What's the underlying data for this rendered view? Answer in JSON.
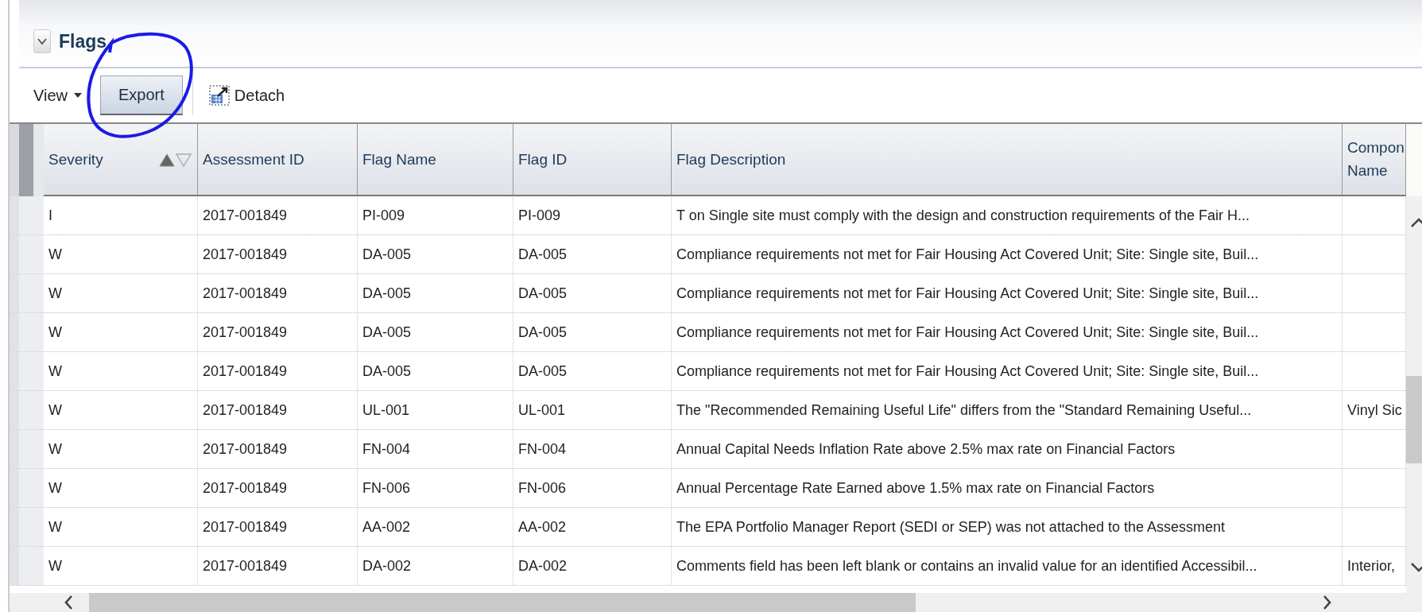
{
  "panel": {
    "title": "Flags",
    "expanded": true
  },
  "toolbar": {
    "view_menu": "View",
    "export_button": "Export",
    "detach_button": "Detach"
  },
  "table": {
    "columns": [
      {
        "label": "Severity",
        "sorted_ascending": true
      },
      {
        "label": "Assessment ID"
      },
      {
        "label": "Flag Name"
      },
      {
        "label": "Flag ID"
      },
      {
        "label": "Flag Description"
      },
      {
        "label": "Compon Name"
      }
    ],
    "rows": [
      [
        "I",
        "2017-001849",
        "PI-009",
        "PI-009",
        "T on Single site must comply with the design and construction requirements of the Fair H...",
        ""
      ],
      [
        "W",
        "2017-001849",
        "DA-005",
        "DA-005",
        "Compliance requirements not met for Fair Housing Act Covered Unit; Site: Single site, Buil...",
        ""
      ],
      [
        "W",
        "2017-001849",
        "DA-005",
        "DA-005",
        "Compliance requirements not met for Fair Housing Act Covered Unit; Site: Single site, Buil...",
        ""
      ],
      [
        "W",
        "2017-001849",
        "DA-005",
        "DA-005",
        "Compliance requirements not met for Fair Housing Act Covered Unit; Site: Single site, Buil...",
        ""
      ],
      [
        "W",
        "2017-001849",
        "DA-005",
        "DA-005",
        "Compliance requirements not met for Fair Housing Act Covered Unit; Site: Single site, Buil...",
        ""
      ],
      [
        "W",
        "2017-001849",
        "UL-001",
        "UL-001",
        "The \"Recommended Remaining Useful Life\" differs from the \"Standard Remaining Useful...",
        "Vinyl Sic"
      ],
      [
        "W",
        "2017-001849",
        "FN-004",
        "FN-004",
        "Annual Capital Needs Inflation Rate above 2.5% max rate on Financial Factors",
        ""
      ],
      [
        "W",
        "2017-001849",
        "FN-006",
        "FN-006",
        "Annual Percentage Rate Earned above 1.5% max rate on Financial Factors",
        ""
      ],
      [
        "W",
        "2017-001849",
        "AA-002",
        "AA-002",
        "The EPA Portfolio Manager Report (SEDI or SEP) was not attached to the Assessment",
        ""
      ],
      [
        "W",
        "2017-001849",
        "DA-002",
        "DA-002",
        "Comments field has been left blank or contains an invalid value for an identified Accessibil...",
        "Interior,"
      ]
    ]
  }
}
